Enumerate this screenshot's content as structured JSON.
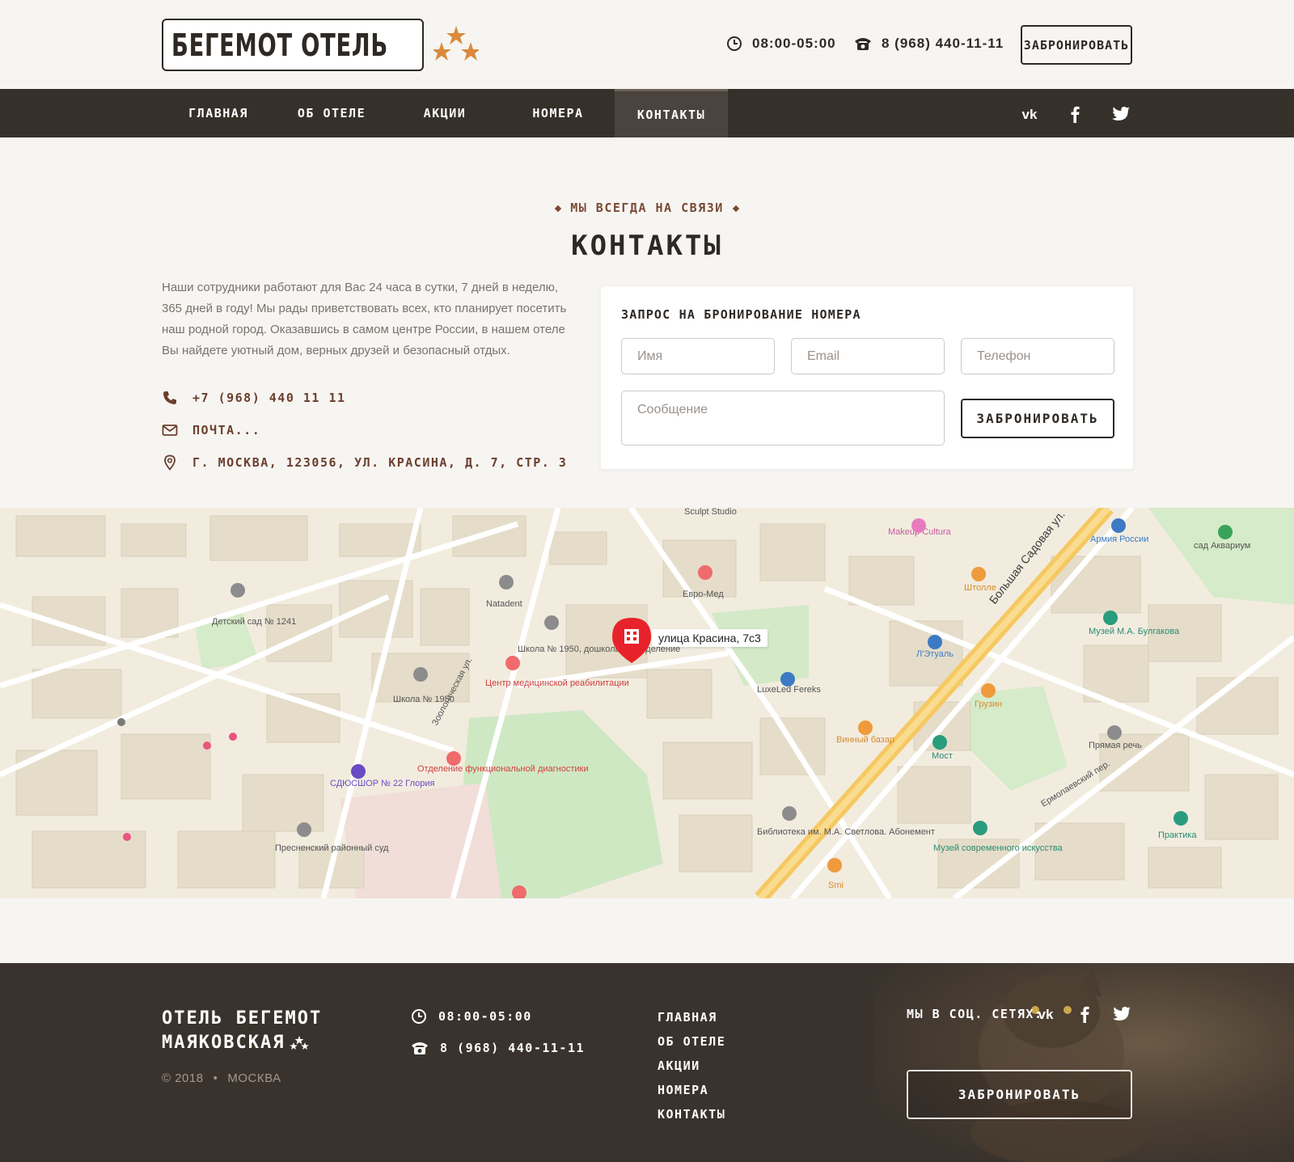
{
  "header": {
    "logo_text": "БЕГЕМОТ ОТЕЛЬ",
    "hours": "08:00-05:00",
    "phone": "8 (968) 440-11-11",
    "book_button": "ЗАБРОНИРОВАТЬ"
  },
  "nav": {
    "items": [
      {
        "label": "ГЛАВНАЯ",
        "active": false
      },
      {
        "label": "ОБ ОТЕЛЕ",
        "active": false
      },
      {
        "label": "АКЦИИ",
        "active": false
      },
      {
        "label": "НОМЕРА",
        "active": false
      },
      {
        "label": "КОНТАКТЫ",
        "active": true
      }
    ],
    "social": [
      "vk-icon",
      "facebook-icon",
      "twitter-icon"
    ]
  },
  "contacts": {
    "eyebrow": "МЫ ВСЕГДА НА СВЯЗИ",
    "title": "КОНТАКТЫ",
    "intro": "Наши сотрудники работают для Вас 24 часа в сутки, 7 дней в неделю, 365 дней в году! Мы рады приветствовать всех, кто планирует посетить наш родной город. Оказавшись в самом центре России, в нашем отеле Вы найдете уютный дом, верных друзей и безопасный отдых.",
    "phone": "+7 (968) 440 11 11",
    "email": "ПОЧТА...",
    "address": "Г. МОСКВА, 123056, УЛ. КРАСИНА, Д. 7, СТР. 3"
  },
  "form": {
    "title": "ЗАПРОС НА БРОНИРОВАНИЕ НОМЕРА",
    "name_placeholder": "Имя",
    "email_placeholder": "Email",
    "phone_placeholder": "Телефон",
    "message_placeholder": "Сообщение",
    "submit": "ЗАБРОНИРОВАТЬ"
  },
  "map": {
    "pin_label": "улица Красина, 7с3",
    "labels": [
      {
        "text": "Sculpt Studio"
      },
      {
        "text": "Makeup Cultura"
      },
      {
        "text": "Армия России"
      },
      {
        "text": "сад Аквариум"
      },
      {
        "text": "Natadent"
      },
      {
        "text": "Евро-Мед"
      },
      {
        "text": "Штолле"
      },
      {
        "text": "Детский сад № 1241"
      },
      {
        "text": "Школа № 1950, дошкольное отделение"
      },
      {
        "text": "Центр медицинской реабилитации"
      },
      {
        "text": "Школа № 1950"
      },
      {
        "text": "LuxeLed Fereks"
      },
      {
        "text": "Л'Этуаль"
      },
      {
        "text": "Грузин"
      },
      {
        "text": "Музей М.А. Булгакова"
      },
      {
        "text": "Винный базар"
      },
      {
        "text": "Мост"
      },
      {
        "text": "Прямая речь"
      },
      {
        "text": "Отделение функциональной диагностики"
      },
      {
        "text": "СДЮСШОР № 22 Глория"
      },
      {
        "text": "Библиотека им. М.А. Светлова. Абонемент"
      },
      {
        "text": "Музей современного искусства"
      },
      {
        "text": "Практика"
      },
      {
        "text": "Пресненский районный суд"
      },
      {
        "text": "Smi"
      },
      {
        "text": "Большая Садовая ул."
      },
      {
        "text": "Зоологическая ул."
      },
      {
        "text": "Ермолаевский пер."
      }
    ]
  },
  "footer": {
    "brand_line1": "ОТЕЛЬ БЕГЕМОТ",
    "brand_line2": "МАЯКОВСКАЯ",
    "copyright": "© 2018",
    "city": "МОСКВА",
    "hours": "08:00-05:00",
    "phone": "8 (968) 440-11-11",
    "nav": [
      "ГЛАВНАЯ",
      "ОБ ОТЕЛЕ",
      "АКЦИИ",
      "НОМЕРА",
      "КОНТАКТЫ"
    ],
    "social_label": "МЫ В СОЦ. СЕТЯХ:",
    "book_button": "ЗАБРОНИРОВАТЬ"
  },
  "colors": {
    "accent_star": "#d98a3c",
    "dark": "#36302b",
    "brown_text": "#6b3f2e",
    "pin_red": "#e8222b"
  }
}
